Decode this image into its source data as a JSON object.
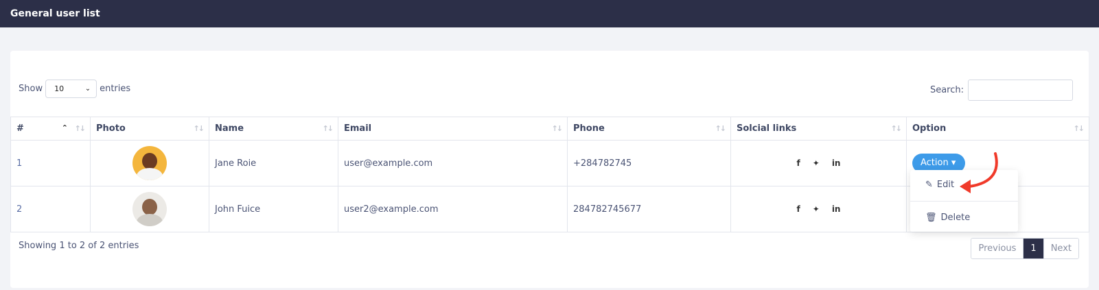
{
  "header": {
    "title": "General user list"
  },
  "controls": {
    "show_label": "Show",
    "entries_value": "10",
    "entries_label": "entries",
    "search_label": "Search:",
    "search_value": ""
  },
  "table": {
    "columns": [
      "#",
      "Photo",
      "Name",
      "Email",
      "Phone",
      "Solcial links",
      "Option"
    ],
    "rows": [
      {
        "id": "1",
        "name": "Jane Roie",
        "email": "user@example.com",
        "phone": "+284782745"
      },
      {
        "id": "2",
        "name": "John Fuice",
        "email": "user2@example.com",
        "phone": "284782745677"
      }
    ],
    "social_icons": [
      "facebook-icon",
      "twitter-icon",
      "linkedin-icon"
    ],
    "action_label": "Action"
  },
  "dropdown": {
    "edit_label": "Edit",
    "delete_label": "Delete"
  },
  "footer": {
    "info": "Showing 1 to 2 of 2 entries",
    "previous": "Previous",
    "page": "1",
    "next": "Next"
  },
  "colors": {
    "topbar": "#2c2f48",
    "accent": "#3d9be9",
    "arrow": "#f03a2a"
  }
}
